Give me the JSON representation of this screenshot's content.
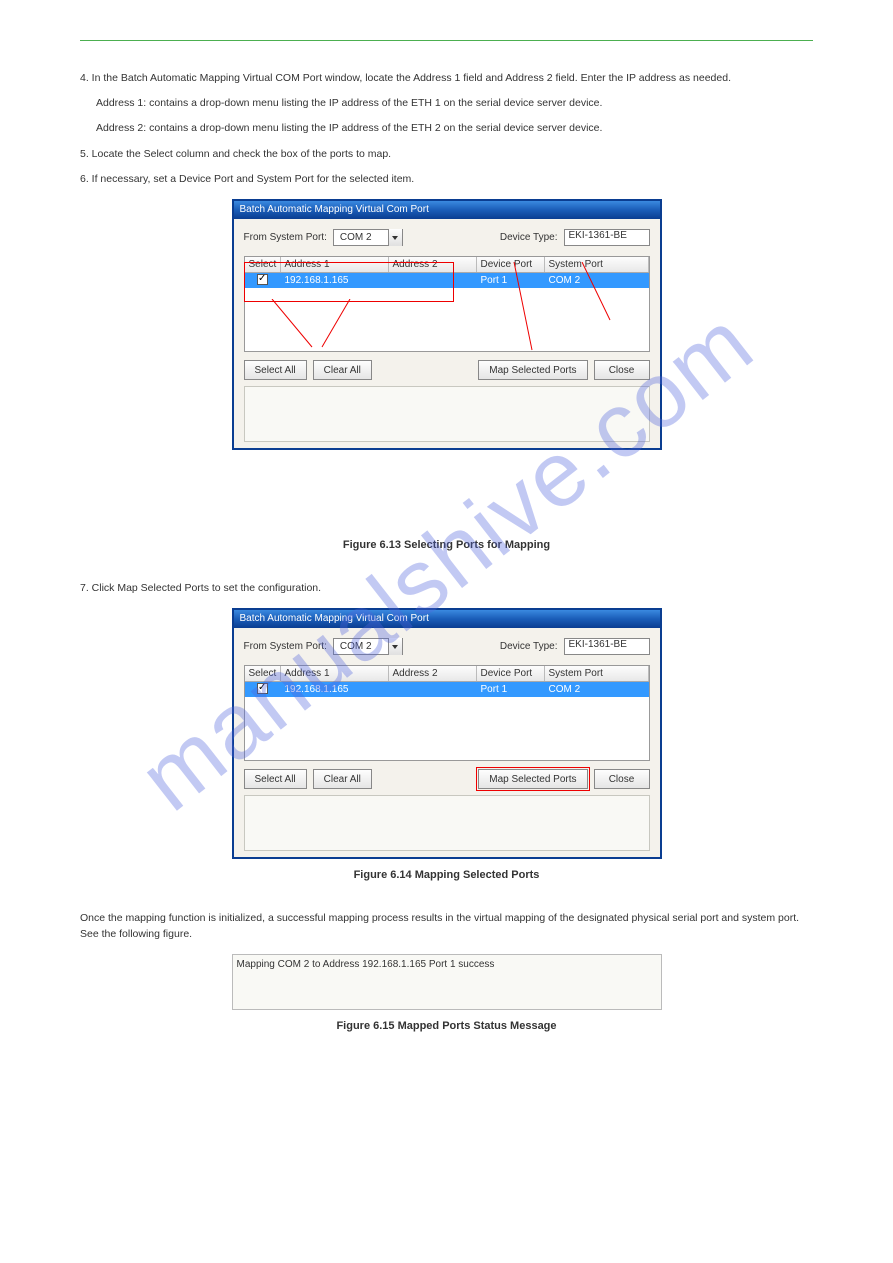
{
  "page": {
    "header_rule": true,
    "watermark": "manualshive.com"
  },
  "paragraphs": {
    "step4": "4. In the Batch Automatic Mapping Virtual COM Port window, locate the Address 1 field and Address 2 field. Enter the IP address as needed.",
    "address1_note": "Address 1: contains a drop-down menu listing the IP address of the ETH 1 on the serial device server device.",
    "address2_note": "Address 2: contains a drop-down menu listing the IP address of the ETH 2 on the serial device server device.",
    "step5": "5. Locate the Select column and check the box of the ports to map.",
    "step6": "6. If necessary, set a Device Port and System Port for the selected item.",
    "fig_caption1": "Figure 6.13 Selecting Ports for Mapping",
    "step7a": "7. Click Map Selected Ports to set the configuration.",
    "fig_caption2": "Figure 6.14 Mapping Selected Ports",
    "step7b": "Once the mapping function is initialized, a successful mapping process results in the virtual mapping of the designated physical serial port and system port. See the following figure.",
    "fig_caption3": "Figure 6.15 Mapped Ports Status Message"
  },
  "dialog1": {
    "title": "Batch Automatic Mapping Virtual Com Port",
    "from_system_port_label": "From System Port:",
    "from_system_port_value": "COM 2",
    "device_type_label": "Device Type:",
    "device_type_value": "EKI-1361-BE",
    "columns": {
      "select": "Select",
      "address1": "Address 1",
      "address2": "Address 2",
      "device_port": "Device Port",
      "system_port": "System Port"
    },
    "row": {
      "address1": "192.168.1.165",
      "address2": "",
      "device_port": "Port 1",
      "system_port": "COM 2"
    },
    "buttons": {
      "select_all": "Select All",
      "clear_all": "Clear All",
      "map_selected": "Map Selected Ports",
      "close": "Close"
    },
    "annotations": {
      "sel": "Select",
      "a1": "Address 1",
      "a2": "Address 2",
      "dport": "Device Port",
      "sport": "System Port"
    }
  },
  "dialog2": {
    "title": "Batch Automatic Mapping Virtual Com Port",
    "from_system_port_label": "From System Port:",
    "from_system_port_value": "COM 2",
    "device_type_label": "Device Type:",
    "device_type_value": "EKI-1361-BE",
    "columns": {
      "select": "Select",
      "address1": "Address 1",
      "address2": "Address 2",
      "device_port": "Device Port",
      "system_port": "System Port"
    },
    "row": {
      "address1": "192.168.1.165",
      "address2": "",
      "device_port": "Port 1",
      "system_port": "COM 2"
    },
    "buttons": {
      "select_all": "Select All",
      "clear_all": "Clear All",
      "map_selected": "Map Selected Ports",
      "close": "Close"
    }
  },
  "status_dialog": {
    "message": "Mapping COM 2 to Address 192.168.1.165 Port 1 success"
  }
}
